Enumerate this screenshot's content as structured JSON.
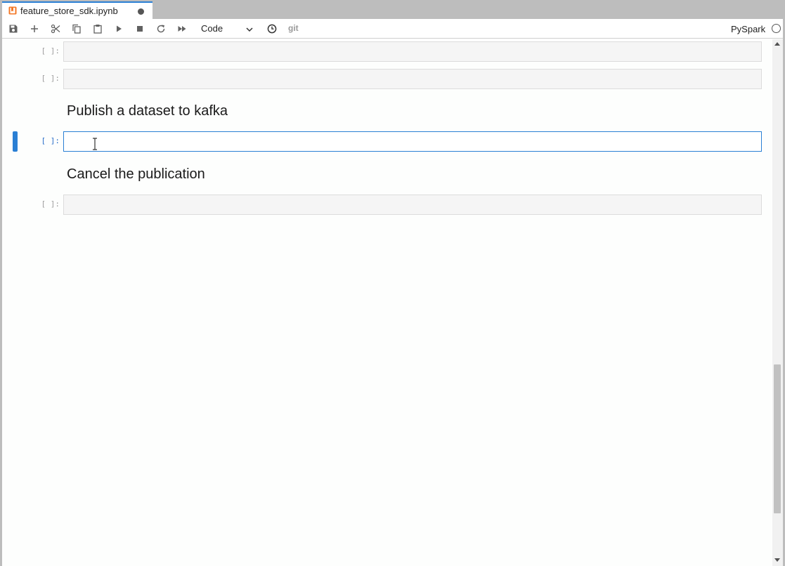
{
  "tab": {
    "title": "feature_store_sdk.ipynb",
    "icon": "notebook-icon",
    "modified_indicator": "unsaved-dot-icon",
    "icon_color": "#f37726",
    "accent_color": "#2a7fd4"
  },
  "toolbar": {
    "buttons": [
      "save-icon",
      "add-cell-icon",
      "cut-icon",
      "copy-icon",
      "paste-icon",
      "run-icon",
      "stop-icon",
      "restart-icon",
      "fast-forward-icon",
      "clock-icon"
    ],
    "cell_type": "Code",
    "git_label": "git",
    "kernel_name": "PySpark",
    "kernel_status": "idle"
  },
  "cells": [
    {
      "type": "code",
      "prompt": "[ ]:",
      "source": ""
    },
    {
      "type": "code",
      "prompt": "[ ]:",
      "source": ""
    },
    {
      "type": "markdown",
      "text": "Publish a dataset to kafka"
    },
    {
      "type": "code",
      "prompt": "[ ]:",
      "source": "",
      "active": true
    },
    {
      "type": "markdown",
      "text": "Cancel the publication"
    },
    {
      "type": "code",
      "prompt": "[ ]:",
      "source": ""
    }
  ]
}
